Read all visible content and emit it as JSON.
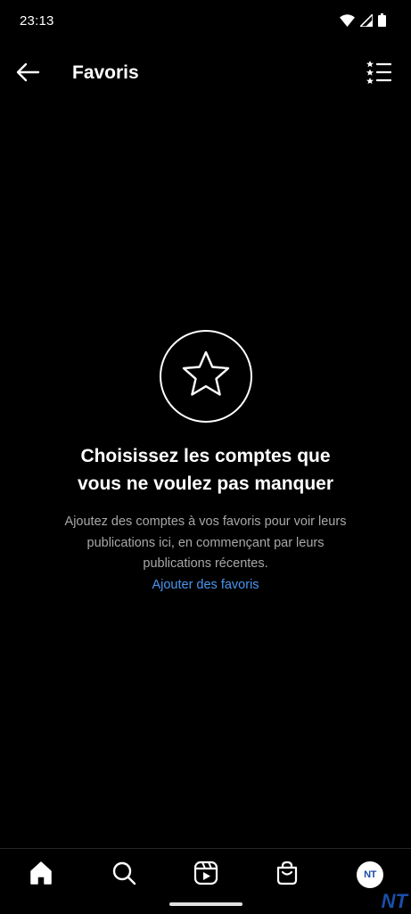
{
  "status_bar": {
    "time": "23:13",
    "icons": [
      "wifi-icon",
      "signal-icon",
      "battery-icon"
    ]
  },
  "header": {
    "title": "Favoris",
    "back_icon": "arrow-left-icon",
    "list_icon": "starred-list-icon"
  },
  "empty_state": {
    "icon": "star-icon",
    "heading": "Choisissez les comptes que vous ne voulez pas manquer",
    "description": "Ajoutez des comptes à vos favoris pour voir leurs publications ici, en commençant par leurs publications récentes.",
    "link": "Ajouter des favoris"
  },
  "bottom_nav": {
    "items": [
      {
        "icon": "home-icon"
      },
      {
        "icon": "search-icon"
      },
      {
        "icon": "reels-icon"
      },
      {
        "icon": "shop-icon"
      },
      {
        "icon": "profile-avatar",
        "initials": "NT"
      }
    ]
  },
  "watermark": "NT",
  "colors": {
    "background": "#000000",
    "text": "#ffffff",
    "secondary_text": "#a8a8a8",
    "link": "#4a96f0"
  }
}
